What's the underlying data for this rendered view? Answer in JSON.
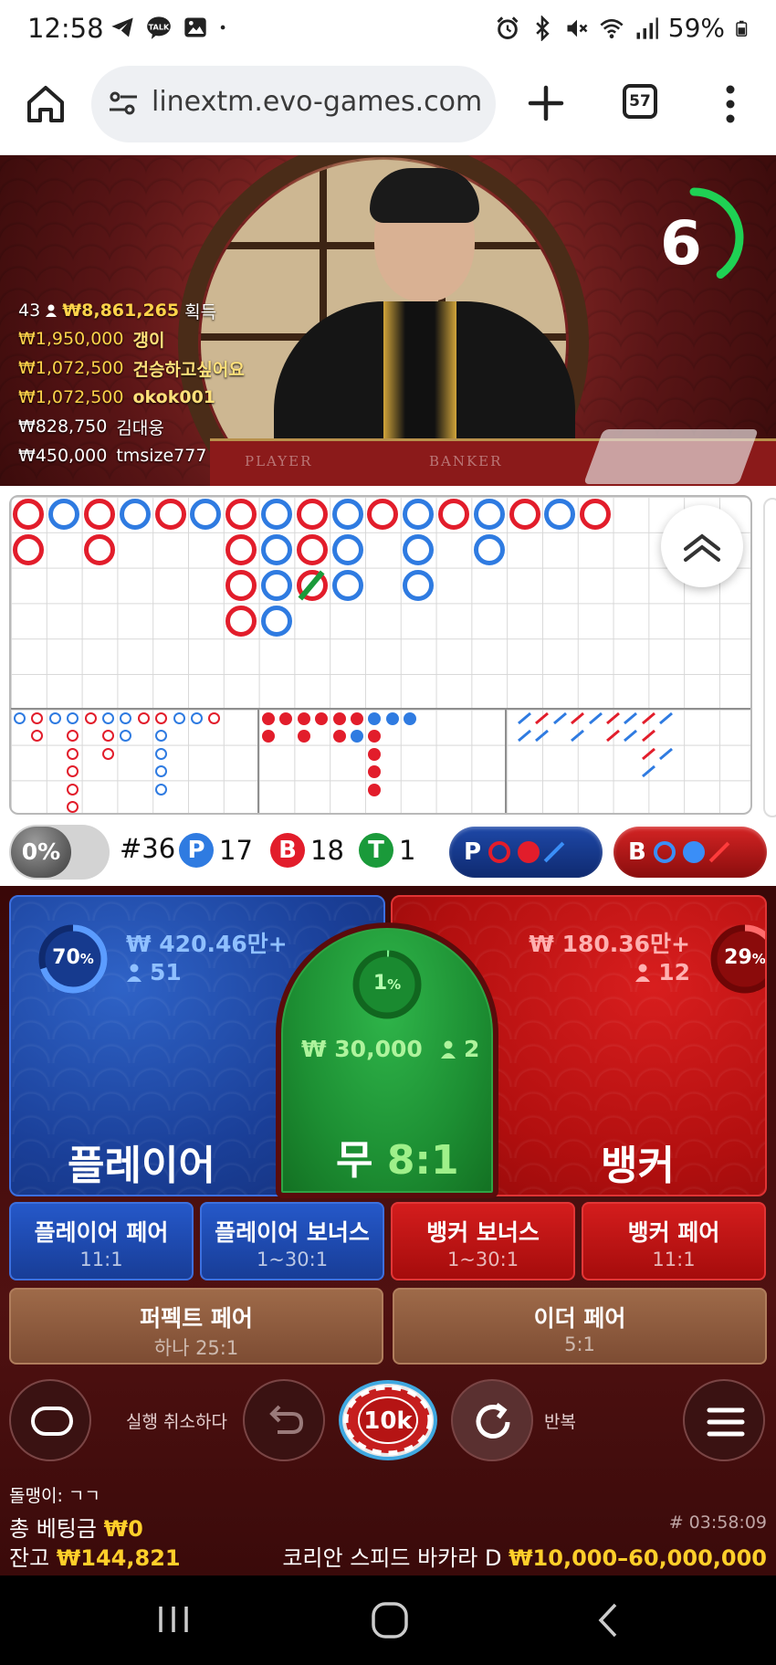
{
  "status_bar": {
    "time": "12:58",
    "battery": "59%"
  },
  "browser": {
    "url": "linextm.evo-games.com",
    "tab_count": "57"
  },
  "video": {
    "timer_value": "6",
    "timer_fraction": 0.4,
    "felt_player": "PLAYER",
    "felt_banker": "BANKER",
    "winners_header": {
      "count": "43",
      "amount": "₩8,861,265",
      "label": "획득"
    },
    "winners": [
      {
        "amount": "₩1,950,000",
        "name": "갱이"
      },
      {
        "amount": "₩1,072,500",
        "name": "건승하고싶어요"
      },
      {
        "amount": "₩1,072,500",
        "name": "okok001"
      },
      {
        "amount": "₩828,750",
        "name": "김대웅"
      },
      {
        "amount": "₩450,000",
        "name": "tmsize777"
      }
    ]
  },
  "stats": {
    "toggle_pct": "0%",
    "round": "#36",
    "player_label": "P",
    "player_count": "17",
    "banker_label": "B",
    "banker_count": "18",
    "tie_label": "T",
    "tie_count": "1",
    "predict_player": "P",
    "predict_banker": "B"
  },
  "bets": {
    "player": {
      "pct": "70",
      "pct_unit": "%",
      "pct_value": 70,
      "amount": "₩ 420.46만+",
      "players": "51",
      "label": "플레이어"
    },
    "tie": {
      "pct": "1",
      "pct_unit": "%",
      "pct_value": 1,
      "amount": "₩ 30,000",
      "players": "2",
      "label": "무",
      "odds": "8:1"
    },
    "banker": {
      "pct": "29",
      "pct_unit": "%",
      "pct_value": 29,
      "amount": "₩ 180.36만+",
      "players": "12",
      "label": "뱅커"
    },
    "side_bets": [
      {
        "title": "플레이어 페어",
        "odds": "11:1"
      },
      {
        "title": "플레이어 보너스",
        "odds": "1~30:1"
      },
      {
        "title": "뱅커 보너스",
        "odds": "1~30:1"
      },
      {
        "title": "뱅커 페어",
        "odds": "11:1"
      }
    ],
    "perfect_pair": {
      "title": "퍼펙트 페어",
      "odds": "하나 25:1"
    },
    "either_pair": {
      "title": "이더 페어",
      "odds": "5:1"
    }
  },
  "controls": {
    "undo_label": "실행 취소하다",
    "chip_value": "10k",
    "repeat_label": "반복"
  },
  "footer": {
    "chat_label": "돌맹이:",
    "chat_message": "ㄱㄱ",
    "total_bet_label": "총 베팅금",
    "total_bet": "₩0",
    "balance_label": "잔고",
    "balance": "₩144,821",
    "game_id": "# 03:58:09",
    "table_name": "코리안 스피드 바카라 D",
    "limits": "₩10,000–60,000,000"
  },
  "colors": {
    "player": "#1a3f98",
    "banker": "#b20f0f",
    "tie": "#1d8f33",
    "gold": "#ffcf2a"
  }
}
